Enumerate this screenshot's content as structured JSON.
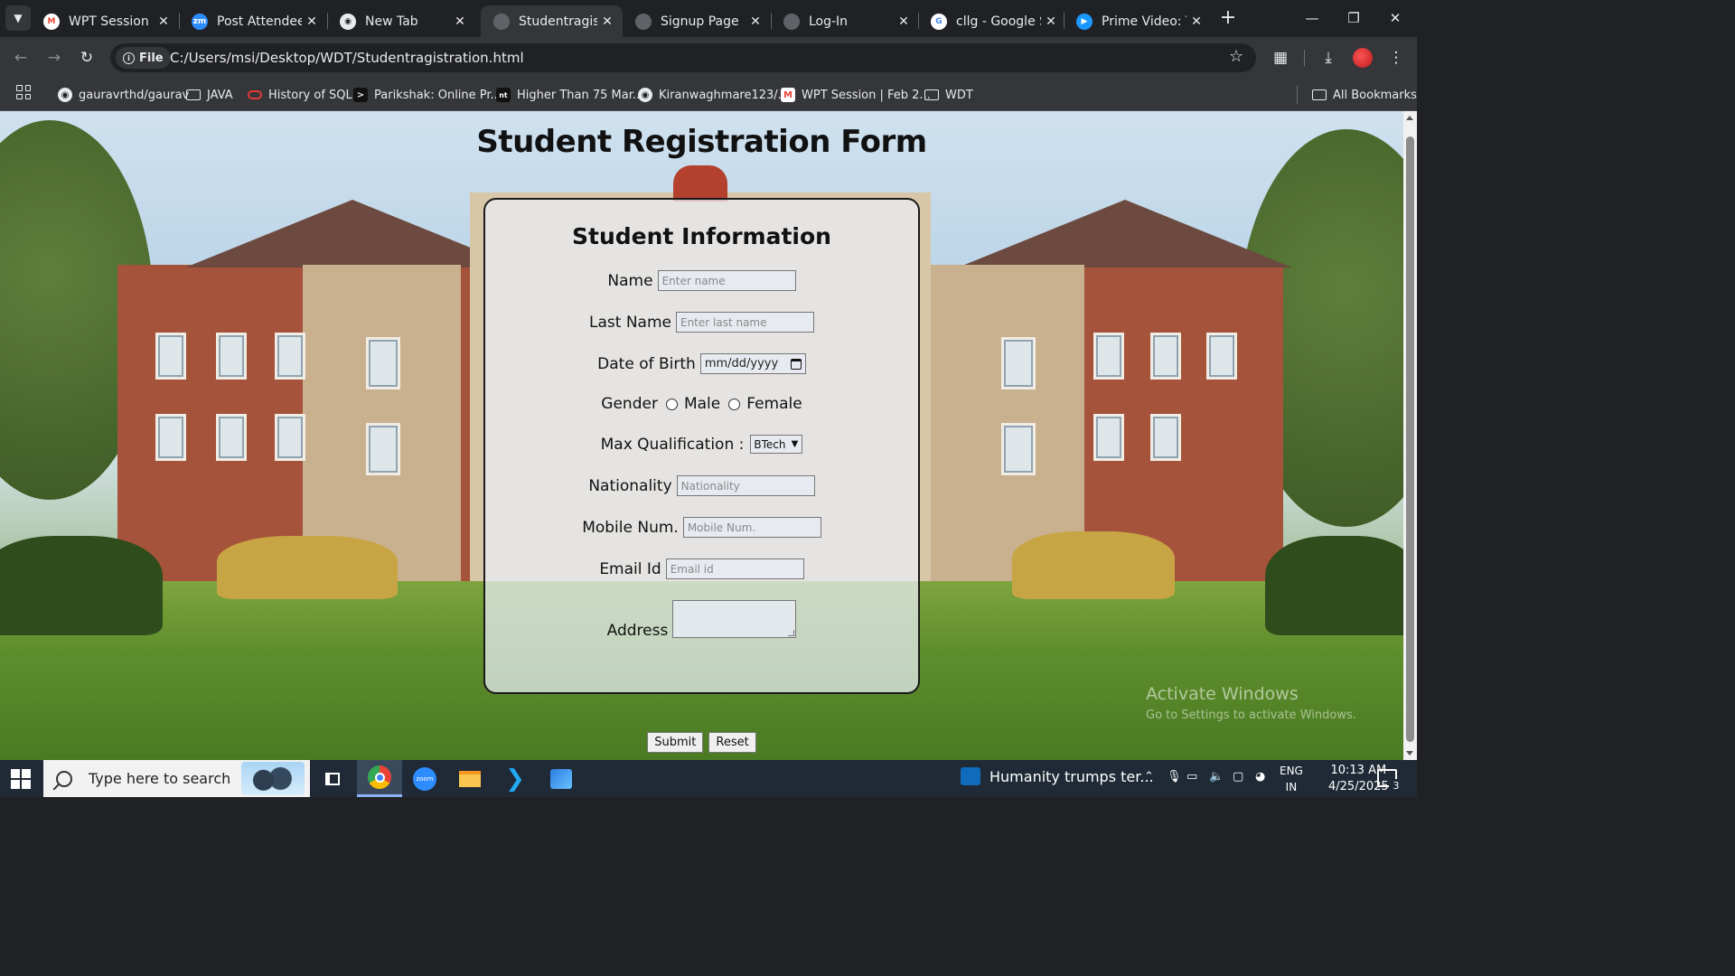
{
  "browser": {
    "tabs": [
      {
        "title": "WPT Session | Fe",
        "favicon": "gmail-icon",
        "color": "#ea4335"
      },
      {
        "title": "Post Attendee - Z",
        "favicon": "zoom-icon",
        "color": "#2d8cff"
      },
      {
        "title": "New Tab",
        "favicon": "chrome-icon",
        "color": "#e8eaed"
      },
      {
        "title": "Studentragistrati",
        "favicon": "globe-icon",
        "color": "#9aa0a6"
      },
      {
        "title": "Signup Page",
        "favicon": "globe-icon",
        "color": "#9aa0a6"
      },
      {
        "title": "Log-In",
        "favicon": "globe-icon",
        "color": "#9aa0a6"
      },
      {
        "title": "cllg - Google Sea",
        "favicon": "google-icon",
        "color": "#4285f4"
      },
      {
        "title": "Prime Video: The",
        "favicon": "prime-video-icon",
        "color": "#1a98ff"
      }
    ],
    "active_tab_index": 3,
    "address": {
      "chip": "File",
      "url": "C:/Users/msi/Desktop/WDT/Studentragistration.html"
    },
    "bookmarks": [
      {
        "label": "gauravrthd/gaurav",
        "icon": "github-icon"
      },
      {
        "label": "JAVA",
        "icon": "folder-icon"
      },
      {
        "label": "History of SQL",
        "icon": "oracle-icon"
      },
      {
        "label": "Parikshak: Online Pr...",
        "icon": "terminal-icon"
      },
      {
        "label": "Higher Than 75 Mar...",
        "icon": "nt-icon"
      },
      {
        "label": "Kiranwaghmare123/...",
        "icon": "github-icon"
      },
      {
        "label": "WPT Session | Feb 2...",
        "icon": "gmail-icon"
      },
      {
        "label": "WDT",
        "icon": "folder-icon"
      }
    ],
    "all_bookmarks": "All Bookmarks"
  },
  "page": {
    "title": "Student Registration Form",
    "card_title": "Student Information",
    "fields": {
      "name": {
        "label": "Name",
        "placeholder": "Enter name"
      },
      "last_name": {
        "label": "Last Name",
        "placeholder": "Enter last name"
      },
      "dob": {
        "label": "Date of Birth",
        "placeholder": "mm/dd/yyyy"
      },
      "gender": {
        "label": "Gender",
        "options": [
          "Male",
          "Female"
        ]
      },
      "qualification": {
        "label": "Max Qualification :",
        "selected": "BTech"
      },
      "nationality": {
        "label": "Nationality",
        "placeholder": "Nationality"
      },
      "mobile": {
        "label": "Mobile Num.",
        "placeholder": "Mobile Num."
      },
      "email": {
        "label": "Email Id",
        "placeholder": "Email id"
      },
      "address": {
        "label": "Address"
      }
    },
    "buttons": {
      "submit": "Submit",
      "reset": "Reset"
    }
  },
  "watermark": {
    "line1": "Activate Windows",
    "line2": "Go to Settings to activate Windows."
  },
  "taskbar": {
    "search_placeholder": "Type here to search",
    "news": "Humanity trumps ter...",
    "lang_top": "ENG",
    "lang_bottom": "IN",
    "time": "10:13 AM",
    "date": "4/25/2025",
    "notification_count": "3"
  }
}
